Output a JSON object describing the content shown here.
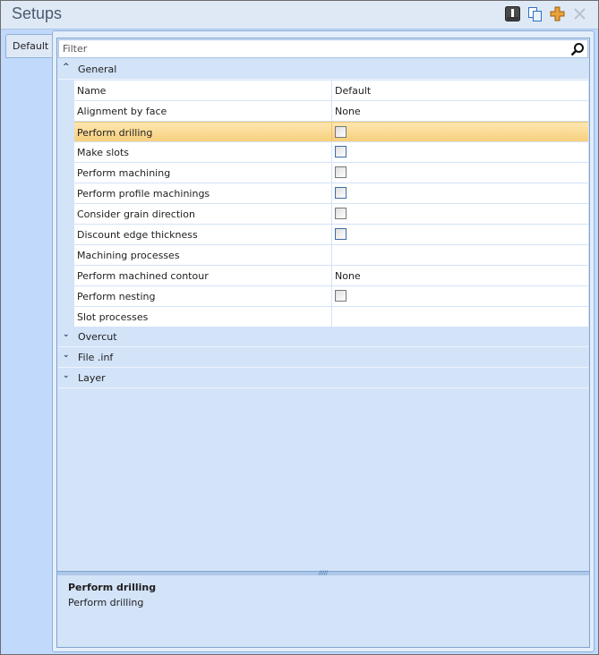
{
  "window": {
    "title": "Setups"
  },
  "toolbar": {
    "icons": [
      "info-icon",
      "copy-icon",
      "add-icon",
      "close-icon"
    ]
  },
  "tabs": [
    {
      "label": "Default"
    }
  ],
  "filter": {
    "placeholder": "Filter",
    "value": ""
  },
  "groups": [
    {
      "label": "General",
      "expanded": true,
      "rows": [
        {
          "name": "Name",
          "value": "Default"
        },
        {
          "name": "Alignment by face",
          "value": "None"
        },
        {
          "name": "Perform drilling",
          "checkbox": false,
          "selected": true
        },
        {
          "name": "Make slots",
          "checkbox": false
        },
        {
          "name": "Perform machining",
          "checkbox": false
        },
        {
          "name": "Perform profile machinings",
          "checkbox": false
        },
        {
          "name": "Consider grain direction",
          "checkbox": false
        },
        {
          "name": "Discount edge thickness",
          "checkbox": false
        },
        {
          "name": "Machining processes",
          "value": ""
        },
        {
          "name": "Perform machined contour",
          "value": "None"
        },
        {
          "name": "Perform nesting",
          "checkbox": false
        },
        {
          "name": "Slot processes",
          "value": ""
        }
      ]
    },
    {
      "label": "Overcut",
      "expanded": false
    },
    {
      "label": "File .inf",
      "expanded": false
    },
    {
      "label": "Layer",
      "expanded": false
    }
  ],
  "description": {
    "title": "Perform drilling",
    "text": "Perform drilling"
  }
}
